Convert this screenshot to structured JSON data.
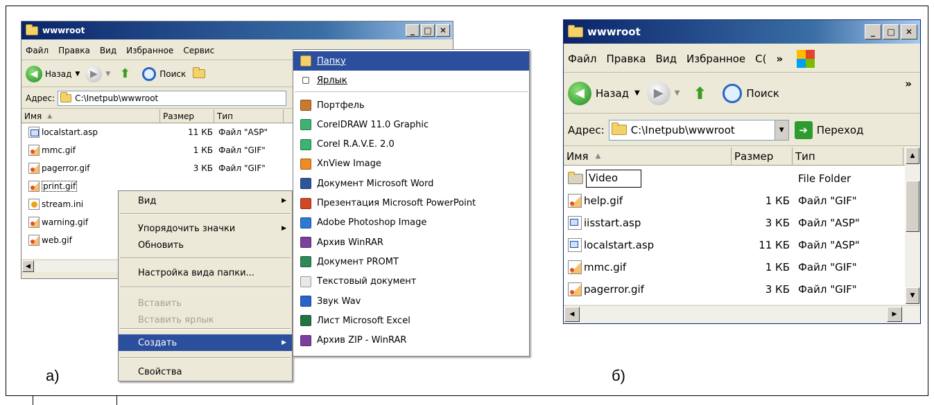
{
  "panel_labels": {
    "a": "а)",
    "b": "б)"
  },
  "left_window": {
    "title": "wwwroot",
    "menu": [
      "Файл",
      "Правка",
      "Вид",
      "Избранное",
      "Сервис"
    ],
    "toolbar": {
      "back": "Назад",
      "search": "Поиск"
    },
    "address_label": "Адрес:",
    "address": "C:\\Inetpub\\wwwroot",
    "columns": [
      "Имя",
      "Размер",
      "Тип"
    ],
    "files": [
      {
        "name": "localstart.asp",
        "size": "11 КБ",
        "type": "Файл \"ASP\"",
        "icon": "asp-file-icon"
      },
      {
        "name": "mmc.gif",
        "size": "1 КБ",
        "type": "Файл \"GIF\"",
        "icon": "gif-file-icon"
      },
      {
        "name": "pagerror.gif",
        "size": "3 КБ",
        "type": "Файл \"GIF\"",
        "icon": "gif-file-icon"
      },
      {
        "name": "print.gif",
        "size": "",
        "type": "",
        "icon": "gif-file-icon"
      },
      {
        "name": "stream.ini",
        "size": "",
        "type": "",
        "icon": "ini-file-icon"
      },
      {
        "name": "warning.gif",
        "size": "",
        "type": "",
        "icon": "gif-file-icon"
      },
      {
        "name": "web.gif",
        "size": "",
        "type": "",
        "icon": "gif-file-icon"
      }
    ]
  },
  "context_menu": {
    "items": [
      {
        "label": "Вид",
        "submenu": true,
        "disabled": false,
        "selected": false
      },
      {
        "label": "Упорядочить значки",
        "submenu": true,
        "disabled": false,
        "selected": false
      },
      {
        "label": "Обновить",
        "submenu": false,
        "disabled": false,
        "selected": false
      },
      {
        "label": "Настройка вида папки...",
        "submenu": false,
        "disabled": false,
        "selected": false
      },
      {
        "label": "Вставить",
        "submenu": false,
        "disabled": true,
        "selected": false
      },
      {
        "label": "Вставить ярлык",
        "submenu": false,
        "disabled": true,
        "selected": false
      },
      {
        "label": "Создать",
        "submenu": true,
        "disabled": false,
        "selected": true
      },
      {
        "label": "Свойства",
        "submenu": false,
        "disabled": false,
        "selected": false
      }
    ]
  },
  "new_submenu": {
    "items": [
      {
        "label": "Папку",
        "icon": "folder-icon",
        "color": "#f3d26a",
        "selected": true
      },
      {
        "label": "Ярлык",
        "icon": "shortcut-icon",
        "color": "#ffffff"
      },
      {
        "label": "Портфель",
        "icon": "briefcase-icon",
        "color": "#c97a2a"
      },
      {
        "label": "CorelDRAW 11.0 Graphic",
        "icon": "coreldraw-icon",
        "color": "#3cb371"
      },
      {
        "label": "Corel R.A.V.E. 2.0",
        "icon": "corel-rave-icon",
        "color": "#3cb371"
      },
      {
        "label": "XnView Image",
        "icon": "xnview-icon",
        "color": "#f08a24"
      },
      {
        "label": "Документ Microsoft Word",
        "icon": "word-icon",
        "color": "#2b579a"
      },
      {
        "label": "Презентация Microsoft PowerPoint",
        "icon": "powerpoint-icon",
        "color": "#d24726"
      },
      {
        "label": "Adobe Photoshop Image",
        "icon": "photoshop-icon",
        "color": "#2d7ad6"
      },
      {
        "label": "Архив WinRAR",
        "icon": "winrar-icon",
        "color": "#7b3fa0"
      },
      {
        "label": "Документ PROMT",
        "icon": "promt-icon",
        "color": "#2e8b57"
      },
      {
        "label": "Текстовый документ",
        "icon": "text-document-icon",
        "color": "#e8e8e8"
      },
      {
        "label": "Звук Wav",
        "icon": "sound-icon",
        "color": "#2a64c8"
      },
      {
        "label": "Лист Microsoft Excel",
        "icon": "excel-icon",
        "color": "#217346"
      },
      {
        "label": "Архив ZIP - WinRAR",
        "icon": "zip-icon",
        "color": "#7b3fa0"
      }
    ]
  },
  "right_window": {
    "title": "wwwroot",
    "menu": [
      "Файл",
      "Правка",
      "Вид",
      "Избранное",
      "С("
    ],
    "toolbar": {
      "back": "Назад",
      "search": "Поиск",
      "more": "»"
    },
    "address_label": "Адрес:",
    "address": "C:\\Inetpub\\wwwroot",
    "go": "Переход",
    "columns": [
      "Имя",
      "Размер",
      "Тип"
    ],
    "rename_value": "Video",
    "files": [
      {
        "name": "",
        "size": "",
        "type": "File Folder",
        "icon": "folder-icon",
        "editing": true
      },
      {
        "name": "help.gif",
        "size": "1 КБ",
        "type": "Файл \"GIF\"",
        "icon": "gif-file-icon"
      },
      {
        "name": "iisstart.asp",
        "size": "3 КБ",
        "type": "Файл \"ASP\"",
        "icon": "asp-file-icon"
      },
      {
        "name": "localstart.asp",
        "size": "11 КБ",
        "type": "Файл \"ASP\"",
        "icon": "asp-file-icon"
      },
      {
        "name": "mmc.gif",
        "size": "1 КБ",
        "type": "Файл \"GIF\"",
        "icon": "gif-file-icon"
      },
      {
        "name": "pagerror.gif",
        "size": "3 КБ",
        "type": "Файл \"GIF\"",
        "icon": "gif-file-icon"
      }
    ]
  }
}
